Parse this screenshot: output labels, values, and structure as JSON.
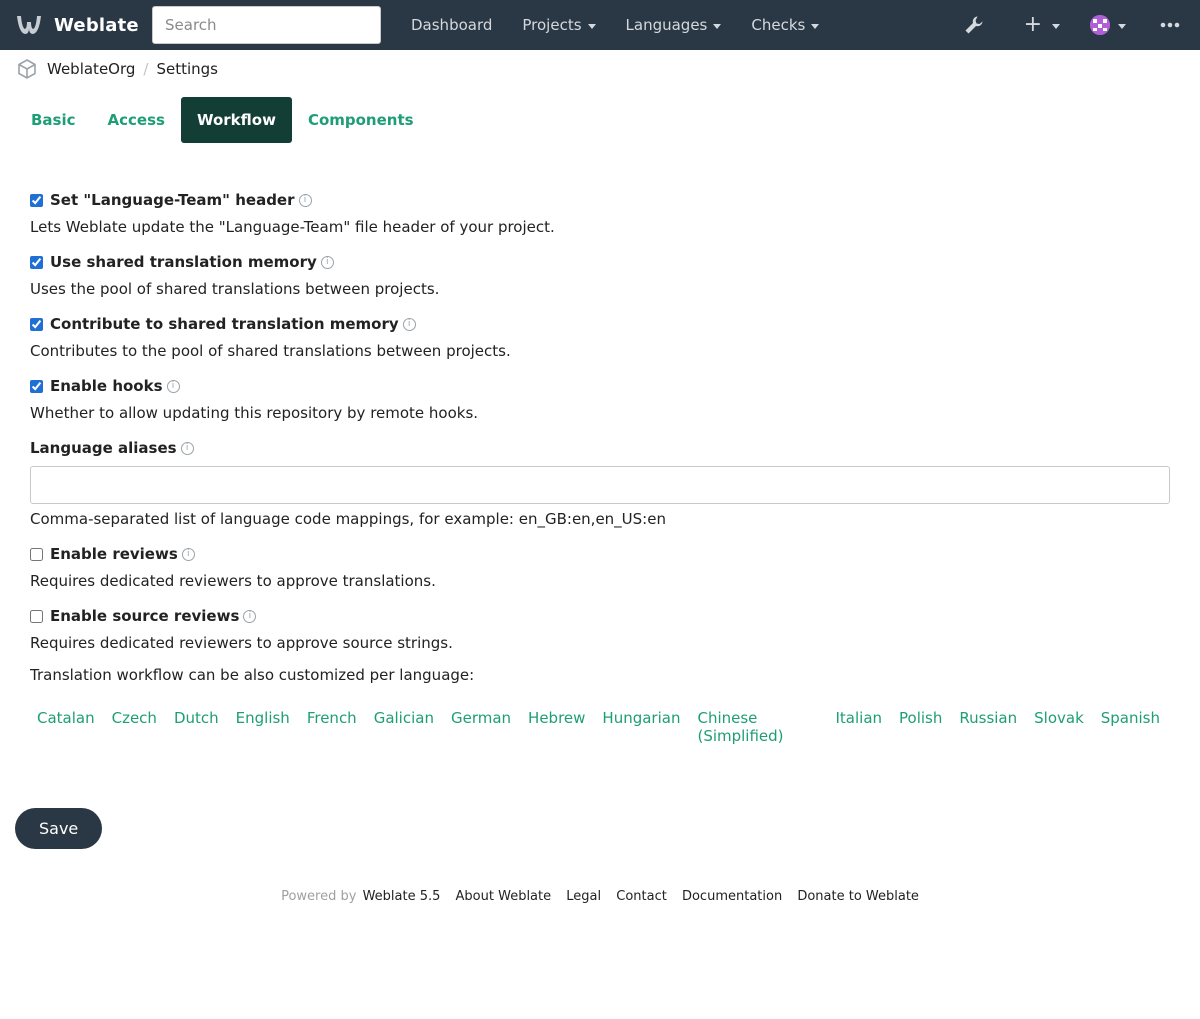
{
  "navbar": {
    "brand": "Weblate",
    "search_placeholder": "Search",
    "items": [
      {
        "label": "Dashboard"
      },
      {
        "label": "Projects"
      },
      {
        "label": "Languages"
      },
      {
        "label": "Checks"
      }
    ],
    "icons": [
      "wrench-icon",
      "plus-icon",
      "avatar",
      "more-icon"
    ]
  },
  "breadcrumb": {
    "organization": "WeblateOrg",
    "page": "Settings"
  },
  "tabs": [
    {
      "label": "Basic"
    },
    {
      "label": "Access"
    },
    {
      "label": "Workflow",
      "active": true
    },
    {
      "label": "Components"
    }
  ],
  "form": {
    "language_team": {
      "label": "Set \"Language-Team\" header",
      "help": "Lets Weblate update the \"Language-Team\" file header of your project.",
      "checked": true
    },
    "use_shared_tm": {
      "label": "Use shared translation memory",
      "help": "Uses the pool of shared translations between projects.",
      "checked": true
    },
    "contribute_shared_tm": {
      "label": "Contribute to shared translation memory",
      "help": "Contributes to the pool of shared translations between projects.",
      "checked": true
    },
    "enable_hooks": {
      "label": "Enable hooks",
      "help": "Whether to allow updating this repository by remote hooks.",
      "checked": true
    },
    "language_aliases": {
      "label": "Language aliases",
      "value": "",
      "help": "Comma-separated list of language code mappings, for example: en_GB:en,en_US:en"
    },
    "enable_reviews": {
      "label": "Enable reviews",
      "help": "Requires dedicated reviewers to approve translations.",
      "checked": false
    },
    "enable_source_reviews": {
      "label": "Enable source reviews",
      "help": "Requires dedicated reviewers to approve source strings.",
      "checked": false
    },
    "workflow_intro": "Translation workflow can be also customized per language:",
    "languages": [
      "Catalan",
      "Czech",
      "Dutch",
      "English",
      "French",
      "Galician",
      "German",
      "Hebrew",
      "Hungarian",
      "Chinese (Simplified)",
      "Italian",
      "Polish",
      "Russian",
      "Slovak",
      "Spanish"
    ],
    "save_label": "Save"
  },
  "footer": {
    "powered_by": "Powered by",
    "version": "Weblate 5.5",
    "links": [
      "About Weblate",
      "Legal",
      "Contact",
      "Documentation",
      "Donate to Weblate"
    ]
  },
  "colors": {
    "navbar": "#2a3744",
    "accent": "#1e9e76",
    "active_tab": "#133e35"
  }
}
